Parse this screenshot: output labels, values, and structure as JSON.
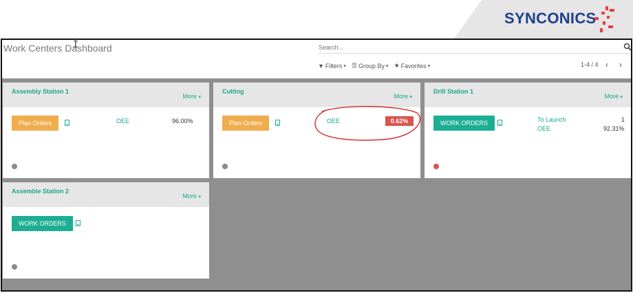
{
  "brand": {
    "logo_text": "SYNCONICS"
  },
  "control_panel": {
    "title": "Work Centers Dashboard",
    "search_placeholder": "Search...",
    "filters_label": "Filters",
    "group_by_label": "Group By",
    "favorites_label": "Favorites",
    "pager": "1-4 / 4"
  },
  "cards": [
    {
      "name": "Assembly Station 1",
      "more_label": "More",
      "button_label": "Plan Orders",
      "button_color": "#f0ad4e",
      "metrics": [
        {
          "label": "OEE",
          "value": "96.00%"
        }
      ],
      "status_color": "#8a8a8a"
    },
    {
      "name": "Cutting",
      "more_label": "More",
      "button_label": "Plan Orders",
      "button_color": "#f0ad4e",
      "metrics": [
        {
          "label": "OEE",
          "value": "0.62%",
          "value_style": "danger-badge"
        }
      ],
      "status_color": "#8a8a8a"
    },
    {
      "name": "Drill Station 1",
      "more_label": "More",
      "button_label": "WORK ORDERS",
      "button_color": "#1cae93",
      "metrics": [
        {
          "label": "To Launch",
          "value": "1"
        },
        {
          "label": "OEE",
          "value": "92.31%"
        }
      ],
      "status_color": "#d9534f"
    },
    {
      "name": "Assemble Station 2",
      "more_label": "More",
      "button_label": "WORK ORDERS",
      "button_color": "#1cae93",
      "metrics": [],
      "status_color": "#8a8a8a"
    }
  ],
  "colors": {
    "accent": "#1aa68a",
    "brand_blue": "#1f3f8f",
    "brand_red": "#e83e3e",
    "annotation": "#d92a2a"
  }
}
